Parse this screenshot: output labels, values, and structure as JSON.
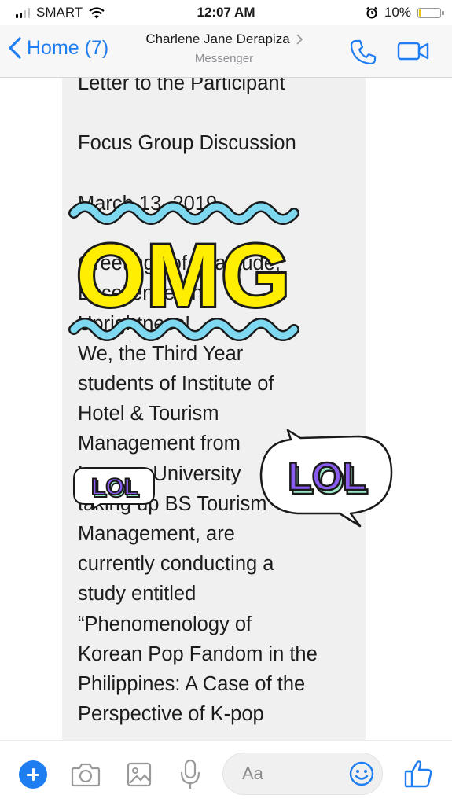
{
  "status_bar": {
    "carrier": "SMART",
    "time": "12:07 AM",
    "battery_percent": "10%",
    "battery_level": 0.1,
    "signal_bars": 2
  },
  "header": {
    "back_label": "Home (7)",
    "contact_name": "Charlene Jane Derapiza",
    "subtitle": "Messenger"
  },
  "message": {
    "lines": [
      "Letter to the Participant",
      "",
      "Focus Group Discussion",
      "",
      "March 13, 2019",
      "",
      "Greetings of Gratitude,",
      "Excellence and",
      "Uprightness!",
      " We, the Third Year",
      "students of Institute of",
      "Hotel & Tourism",
      "Management from",
      "Lyceum University",
      "taking up BS Tourism",
      "Management, are",
      "currently conducting a",
      "study entitled",
      "“Phenomenology of",
      "Korean Pop Fandom in the",
      "Philippines: A Case of the",
      "Perspective of K-pop"
    ]
  },
  "stickers": {
    "omg": "OMG",
    "lol_small": "LOL",
    "lol_large": "LOL"
  },
  "composer": {
    "placeholder": "Aa"
  },
  "colors": {
    "accent": "#1f7df2",
    "bubble": "#f0f0f0",
    "sticker_yellow": "#ffee00",
    "sticker_blue": "#7dd8f0",
    "sticker_purple": "#8b5cf0",
    "sticker_green": "#9ee8c8"
  },
  "icons": {
    "back": "chevron-left-icon",
    "contact_chevron": "chevron-right-icon",
    "call": "phone-icon",
    "video": "video-camera-icon",
    "plus": "plus-icon",
    "camera": "camera-icon",
    "gallery": "image-icon",
    "mic": "microphone-icon",
    "emoji": "smiley-icon",
    "like": "thumbs-up-icon",
    "alarm": "alarm-clock-icon",
    "wifi": "wifi-icon"
  }
}
